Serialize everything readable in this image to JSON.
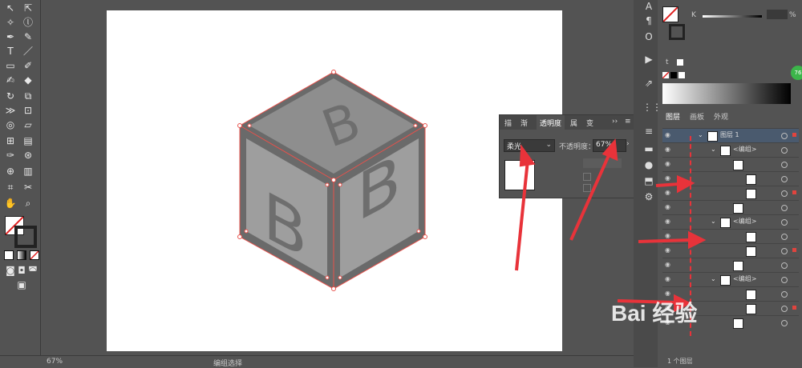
{
  "transparency_panel": {
    "tabs": [
      "描",
      "渐",
      "透明度",
      "属",
      "变"
    ],
    "more": "››",
    "blend_mode": "柔光",
    "opacity_label": "不透明度：",
    "opacity_value": "67%"
  },
  "layers_panel": {
    "tabs": [
      "图层",
      "画板",
      "外观"
    ],
    "rows": [
      {
        "name": "图层 1"
      },
      {
        "name": "<编组>"
      },
      {
        "name": "<编组>"
      },
      {
        "name": "<编组>"
      }
    ],
    "footer": "1 个图层"
  },
  "color_panel": {
    "channel": "K",
    "percent": "%"
  },
  "bottom_bar": {
    "zoom": "67%",
    "status": "编组选择"
  },
  "canvas": {
    "letter": "B"
  },
  "accent_colors": {
    "selection": "#e8514b",
    "arrow": "#e8333a",
    "badge": "#3cb54a"
  },
  "watermark": "Bai 经验",
  "badge_text": "76"
}
